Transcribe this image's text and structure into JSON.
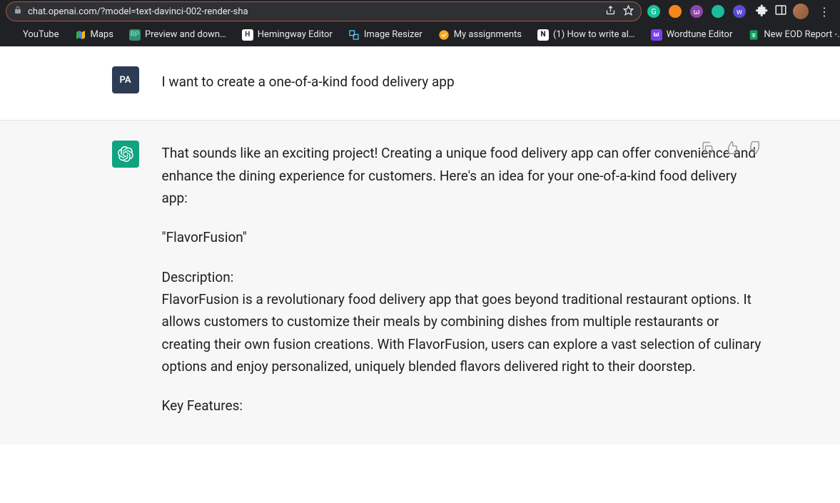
{
  "browser": {
    "url": "chat.openai.com/?model=text-davinci-002-render-sha",
    "toolbar_icons": [
      {
        "name": "grammarly-icon",
        "bg": "#15c39a",
        "glyph": "G"
      },
      {
        "name": "metamask-icon",
        "bg": "#f6851b",
        "glyph": ""
      },
      {
        "name": "purple-circle-icon",
        "bg": "#8e44ad",
        "glyph": "ω"
      },
      {
        "name": "teal-circle-icon",
        "bg": "#1abc9c",
        "glyph": ""
      },
      {
        "name": "wordtune-icon",
        "bg": "#5b4bd6",
        "glyph": "w"
      }
    ],
    "bookmarks": [
      {
        "label": "YouTube",
        "icon_bg": "transparent",
        "icon_glyph": ""
      },
      {
        "label": "Maps",
        "icon_bg": "",
        "icon_glyph": "",
        "icon_svg": "maps"
      },
      {
        "label": "Preview and down…",
        "icon_bg": "#2f8f6f",
        "icon_glyph": "RP",
        "icon_color": "#6dd5b6"
      },
      {
        "label": "Hemingway Editor",
        "icon_bg": "#fff",
        "icon_glyph": "H",
        "icon_text_color": "#333"
      },
      {
        "label": "Image Resizer",
        "icon_bg": "",
        "icon_glyph": "",
        "icon_svg": "resize"
      },
      {
        "label": "My assignments",
        "icon_bg": "",
        "icon_glyph": "",
        "icon_svg": "assign"
      },
      {
        "label": "(1) How to write al…",
        "icon_bg": "#fff",
        "icon_glyph": "N",
        "icon_text_color": "#111"
      },
      {
        "label": "Wordtune Editor",
        "icon_bg": "#7b3ff2",
        "icon_glyph": "ω"
      },
      {
        "label": "New EOD Report -…",
        "icon_bg": "#0f9d58",
        "icon_glyph": "",
        "icon_svg": "sheet"
      }
    ]
  },
  "conversation": {
    "user": {
      "avatar_initials": "PA",
      "text": "I want to create a one-of-a-kind food delivery app"
    },
    "assistant": {
      "paragraphs": [
        "That sounds like an exciting project! Creating a unique food delivery app can offer convenience and enhance the dining experience for customers. Here's an idea for your one-of-a-kind food delivery app:",
        "\"FlavorFusion\"",
        "Description:\nFlavorFusion is a revolutionary food delivery app that goes beyond traditional restaurant options. It allows customers to customize their meals by combining dishes from multiple restaurants or creating their own fusion creations. With FlavorFusion, users can explore a vast selection of culinary options and enjoy personalized, uniquely blended flavors delivered right to their doorstep.",
        "Key Features:"
      ]
    }
  }
}
